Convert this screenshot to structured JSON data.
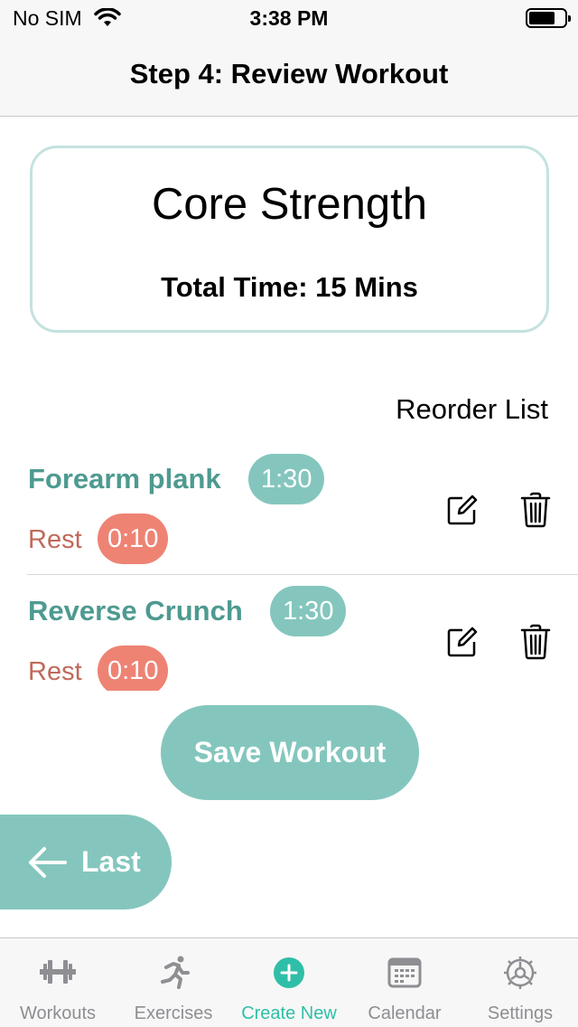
{
  "status_bar": {
    "carrier": "No SIM",
    "time": "3:38 PM"
  },
  "nav": {
    "title": "Step 4: Review Workout"
  },
  "summary": {
    "workout_name": "Core Strength",
    "total_time": "Total Time: 15 Mins"
  },
  "reorder_label": "Reorder List",
  "exercises": [
    {
      "name": "Forearm plank",
      "duration": "1:30",
      "rest_label": "Rest",
      "rest_duration": "0:10"
    },
    {
      "name": "Reverse Crunch",
      "duration": "1:30",
      "rest_label": "Rest",
      "rest_duration": "0:10"
    }
  ],
  "buttons": {
    "save": "Save Workout",
    "last": "Last"
  },
  "tabs": [
    {
      "label": "Workouts",
      "icon": "dumbbell-icon"
    },
    {
      "label": "Exercises",
      "icon": "running-person-icon"
    },
    {
      "label": "Create New",
      "icon": "plus-circle-icon",
      "active": true
    },
    {
      "label": "Calendar",
      "icon": "calendar-icon"
    },
    {
      "label": "Settings",
      "icon": "gear-icon"
    }
  ],
  "colors": {
    "accent": "#84c6bd",
    "exercise_text": "#4e9a90",
    "rest": "#ee8374",
    "rest_text": "#c0695b",
    "active_tab": "#2fbfa8",
    "inactive_tab": "#8e8e93"
  }
}
